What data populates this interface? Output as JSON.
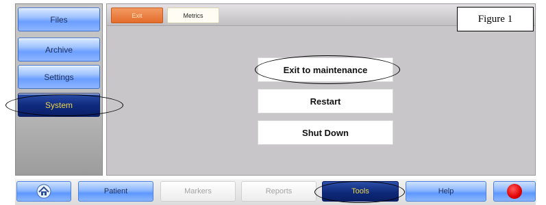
{
  "sidebar": {
    "items": [
      {
        "label": "Files",
        "active": false
      },
      {
        "label": "Archive",
        "active": false
      },
      {
        "label": "Settings",
        "active": false
      },
      {
        "label": "System",
        "active": true
      }
    ]
  },
  "tabs": [
    {
      "label": "Exit",
      "active": true
    },
    {
      "label": "Metrics",
      "active": false
    }
  ],
  "actions": [
    {
      "label": "Exit to maintenance"
    },
    {
      "label": "Restart"
    },
    {
      "label": "Shut Down"
    }
  ],
  "figure_label": "Figure 1",
  "bottombar": {
    "home_icon": "home-icon",
    "buttons": [
      {
        "label": "Patient",
        "state": "enabled"
      },
      {
        "label": "Markers",
        "state": "disabled"
      },
      {
        "label": "Reports",
        "state": "disabled"
      },
      {
        "label": "Tools",
        "state": "active"
      },
      {
        "label": "Help",
        "state": "enabled"
      }
    ],
    "record_icon": "record-icon"
  },
  "colors": {
    "active_navy": "#0a1f66",
    "active_text": "#f2d84a",
    "tab_orange": "#e46c2a",
    "button_blue": "#6b9eff",
    "panel_gray": "#c9c6c9",
    "record_red": "#e00000"
  }
}
